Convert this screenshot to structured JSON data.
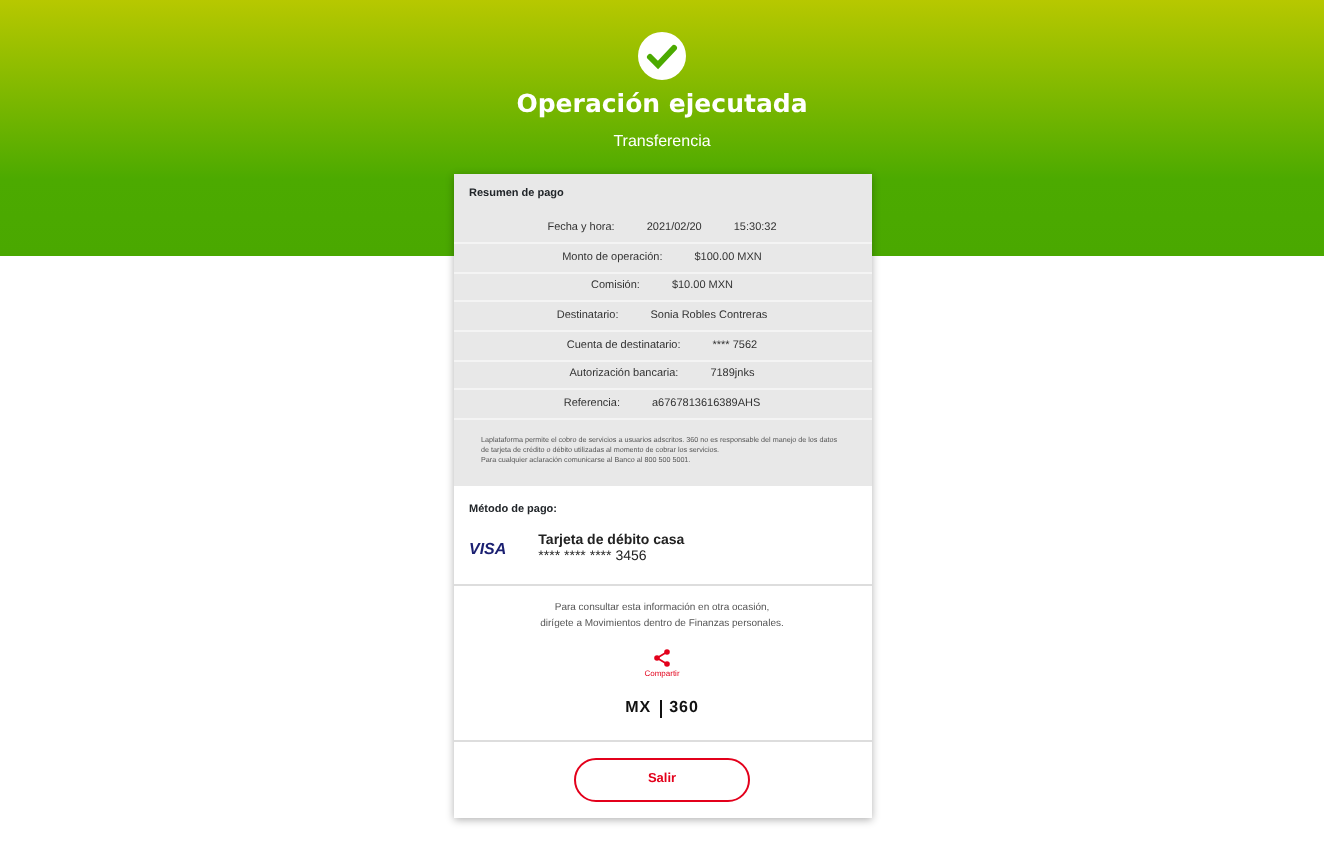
{
  "header": {
    "title": "Operación ejecutada",
    "subtitle": "Transferencia"
  },
  "summary": {
    "title": "Resumen de pago",
    "rows": [
      {
        "label": "Fecha y hora:",
        "values": [
          "2021/02/20",
          "15:30:32"
        ]
      },
      {
        "label": "Monto de operación:",
        "values": [
          "$100.00 MXN"
        ]
      },
      {
        "label": "Comisión:",
        "values": [
          "$10.00 MXN"
        ]
      },
      {
        "label": "Destinatario:",
        "values": [
          "Sonia Robles Contreras"
        ]
      },
      {
        "label": "Cuenta de destinatario:",
        "values": [
          "**** 7562"
        ]
      },
      {
        "label": "Autorización bancaria:",
        "values": [
          "7189jnks"
        ]
      },
      {
        "label": "Referencia:",
        "values": [
          "a6767813616389AHS"
        ]
      }
    ],
    "disclaimer": [
      "Laplataforma permite el cobro de servicios a usuarios adscritos. 360 no es responsable del manejo de los datos de tarjeta de crédito o débito utilizadas al momento de cobrar los servicios.",
      "Para cualquier aclaración comunicarse al Banco al 800 500 5001."
    ]
  },
  "payment_method": {
    "title": "Método de pago:",
    "brand": "VISA",
    "card_name": "Tarjeta de débito casa",
    "card_number": "**** **** **** 3456"
  },
  "info": {
    "text": [
      "Para consultar esta información en otra ocasión,",
      "dirígete a Movimientos dentro de Finanzas personales."
    ],
    "share_label": "Compartir",
    "logo": [
      "MX",
      "360"
    ]
  },
  "exit_button": "Salir"
}
